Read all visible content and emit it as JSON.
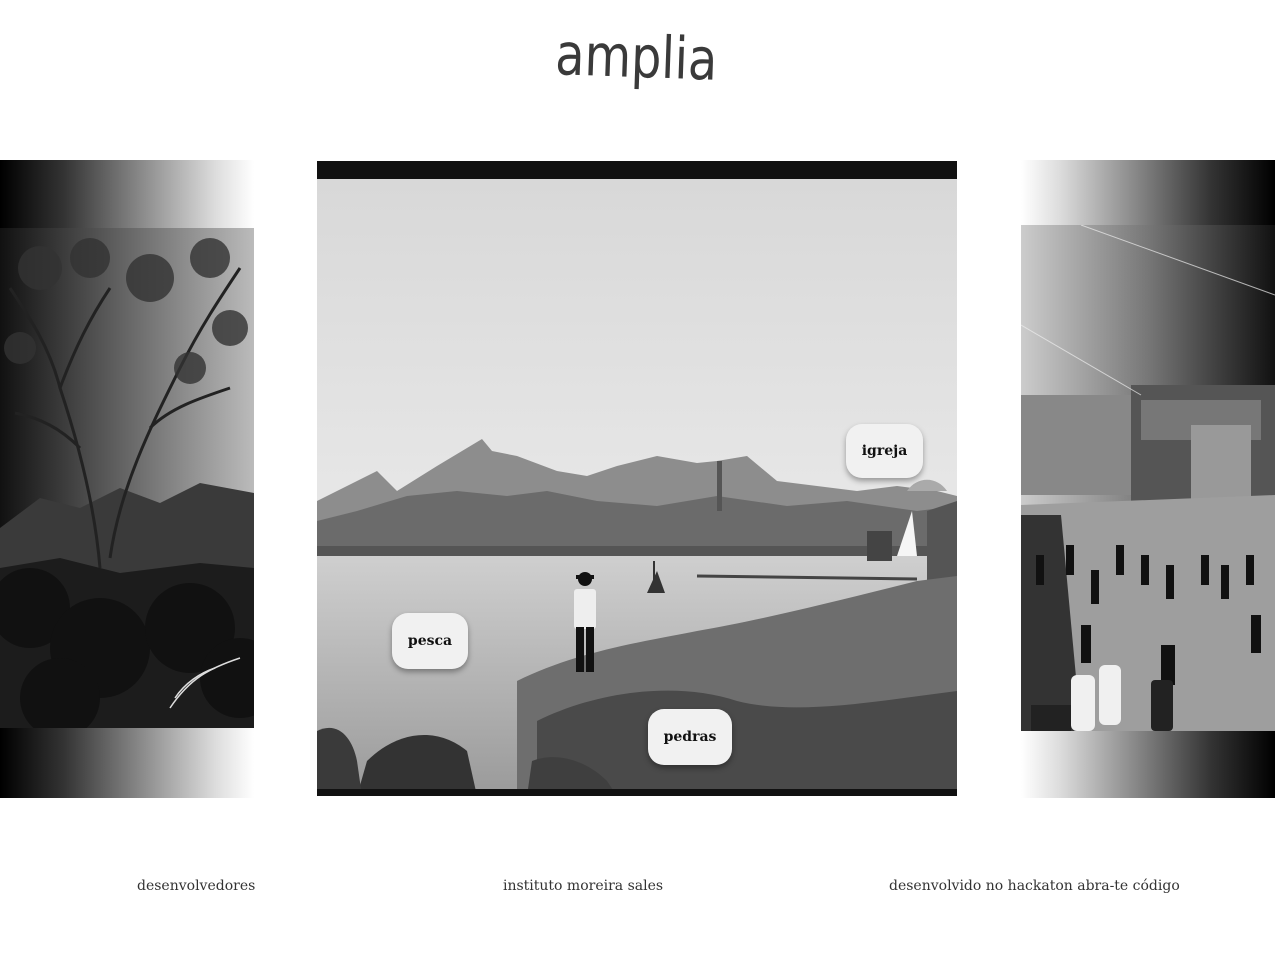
{
  "header": {
    "logo_text": "amplia"
  },
  "gallery": {
    "main_photo": {
      "tags": [
        {
          "label": "igreja"
        },
        {
          "label": "pesca"
        },
        {
          "label": "pedras"
        }
      ]
    }
  },
  "footer": {
    "links": [
      {
        "label": "desenvolvedores"
      },
      {
        "label": "instituto moreira sales"
      },
      {
        "label": "desenvolvido no hackaton abra-te código"
      }
    ]
  }
}
